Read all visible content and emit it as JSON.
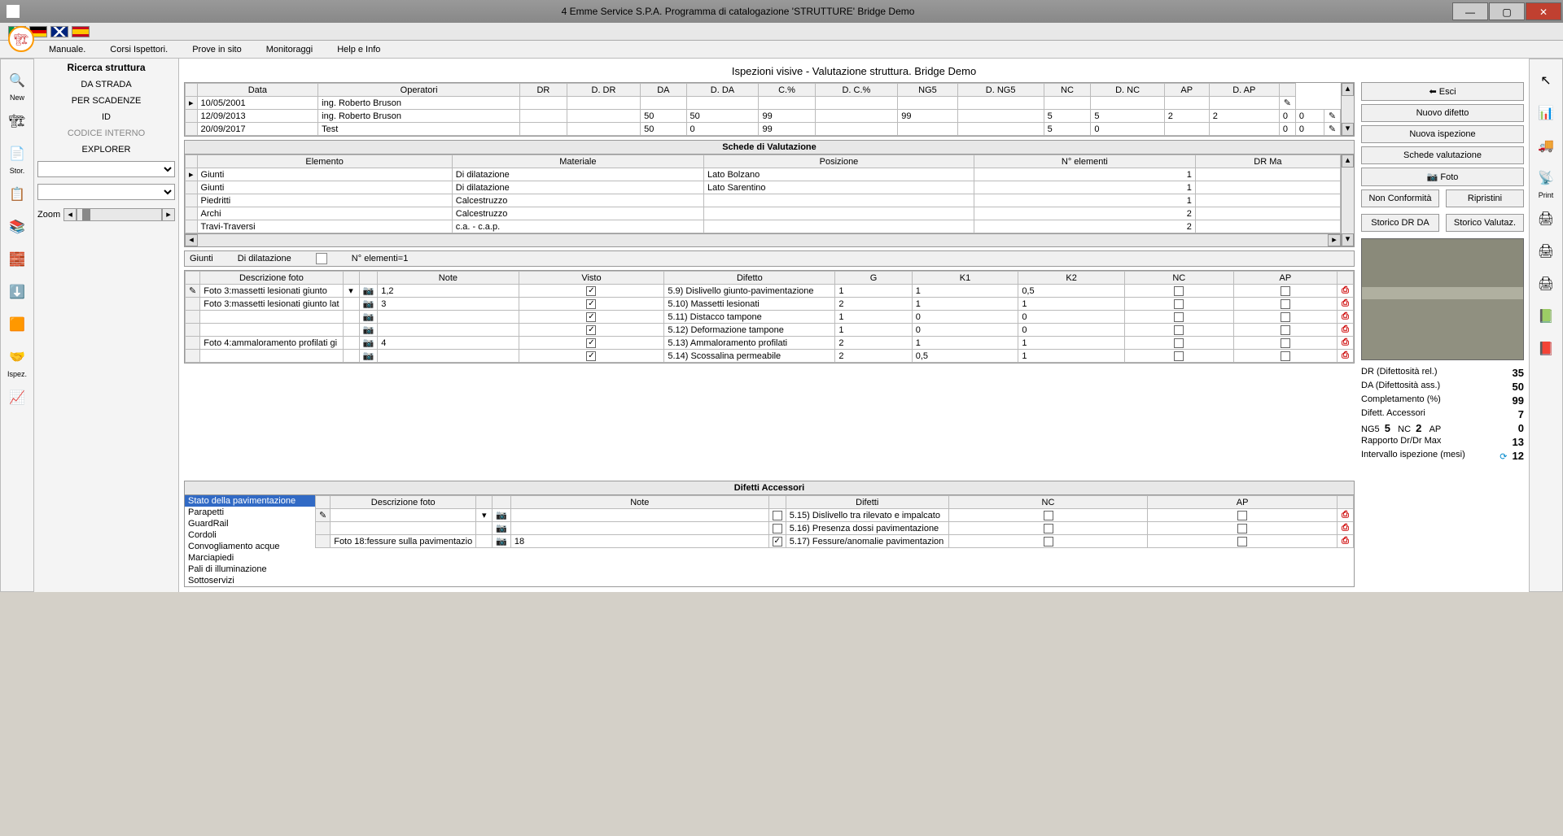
{
  "window": {
    "title": "4 Emme Service S.P.A.  Programma di catalogazione 'STRUTTURE'  Bridge Demo"
  },
  "menus": [
    "Manuale.",
    "Corsi Ispettori.",
    "Prove in sito",
    "Monitoraggi",
    "Help e Info"
  ],
  "leftTools": [
    {
      "icon": "🔍",
      "label": "New"
    },
    {
      "icon": "🏗",
      "label": ""
    },
    {
      "icon": "📄",
      "label": "Stor."
    },
    {
      "icon": "📋",
      "label": ""
    },
    {
      "icon": "📚",
      "label": ""
    },
    {
      "icon": "🧱",
      "label": ""
    },
    {
      "icon": "⬇️",
      "label": ""
    },
    {
      "icon": "🟧",
      "label": ""
    },
    {
      "icon": "🤝",
      "label": "Ispez."
    },
    {
      "icon": "📈",
      "label": ""
    }
  ],
  "rightTools": [
    "↖",
    "📊",
    "🚚",
    "📡",
    "Print",
    "🖨",
    "🖨",
    "🖨",
    "📗",
    "📕"
  ],
  "side": {
    "title": "Ricerca struttura",
    "items": [
      "DA STRADA",
      "PER SCADENZE",
      "ID",
      "CODICE INTERNO",
      "EXPLORER"
    ],
    "zoom": "Zoom"
  },
  "page": {
    "title": "Ispezioni  visive - Valutazione struttura.  Bridge Demo"
  },
  "inspHdr": [
    "Data",
    "Operatori",
    "DR",
    "D. DR",
    "DA",
    "D. DA",
    "C.%",
    "D. C.%",
    "NG5",
    "D. NG5",
    "NC",
    "D. NC",
    "AP",
    "D. AP"
  ],
  "insp": [
    {
      "d": "10/05/2001",
      "op": "ing. Roberto Bruson",
      "v": [
        "",
        "",
        "",
        "",
        "",
        "",
        "",
        "",
        "",
        "",
        "",
        ""
      ]
    },
    {
      "d": "12/09/2013",
      "op": "ing. Roberto Bruson",
      "v": [
        "",
        "",
        "50",
        "50",
        "99",
        "",
        "99",
        "",
        "5",
        "5",
        "2",
        "2",
        "0",
        "0"
      ]
    },
    {
      "d": "20/09/2017",
      "op": "Test",
      "v": [
        "",
        "",
        "50",
        "0",
        "99",
        "",
        "",
        "",
        "5",
        "0",
        "",
        "",
        "0",
        "0"
      ]
    }
  ],
  "schedeTitle": "Schede di Valutazione",
  "schedeHdr": [
    "Elemento",
    "Materiale",
    "Posizione",
    "N° elementi",
    "DR Ma"
  ],
  "schede": [
    {
      "e": "Giunti",
      "m": "Di dilatazione",
      "p": "Lato Bolzano",
      "n": "1",
      "d": ""
    },
    {
      "e": "Giunti",
      "m": "Di dilatazione",
      "p": "Lato Sarentino",
      "n": "1",
      "d": ""
    },
    {
      "e": "Piedritti",
      "m": "Calcestruzzo",
      "p": "",
      "n": "1",
      "d": ""
    },
    {
      "e": "Archi",
      "m": "Calcestruzzo",
      "p": "",
      "n": "2",
      "d": ""
    },
    {
      "e": "Travi-Traversi",
      "m": "c.a. - c.a.p.",
      "p": "",
      "n": "2",
      "d": ""
    }
  ],
  "filter": {
    "a": "Giunti",
    "b": "Di dilatazione",
    "c": "N° elementi=1"
  },
  "defHdr": [
    "Descrizione foto",
    "",
    "",
    "Note",
    "Visto",
    "Difetto",
    "G",
    "K1",
    "K2",
    "NC",
    "AP",
    ""
  ],
  "def": [
    {
      "desc": "Foto 3:massetti lesionati giunto",
      "note": "1,2",
      "visto": true,
      "dif": "5.9) Dislivello giunto-pavimentazione",
      "g": "1",
      "k1": "1",
      "k2": "0,5"
    },
    {
      "desc": "Foto 3:massetti lesionati giunto lat",
      "note": "3",
      "visto": true,
      "dif": "5.10) Massetti lesionati",
      "g": "2",
      "k1": "1",
      "k2": "1"
    },
    {
      "desc": "",
      "note": "",
      "visto": true,
      "dif": "5.11) Distacco tampone",
      "g": "1",
      "k1": "0",
      "k2": "0"
    },
    {
      "desc": "",
      "note": "",
      "visto": true,
      "dif": "5.12) Deformazione tampone",
      "g": "1",
      "k1": "0",
      "k2": "0"
    },
    {
      "desc": "Foto 4:ammaloramento profilati gi",
      "note": "4",
      "visto": true,
      "dif": "5.13) Ammaloramento profilati",
      "g": "2",
      "k1": "1",
      "k2": "1"
    },
    {
      "desc": "",
      "note": "",
      "visto": true,
      "dif": "5.14) Scossalina permeabile",
      "g": "2",
      "k1": "0,5",
      "k2": "1"
    }
  ],
  "buttons": {
    "esci": "Esci",
    "nuovoDifetto": "Nuovo difetto",
    "nuovaIsp": "Nuova ispezione",
    "schedeVal": "Schede valutazione",
    "foto": "Foto",
    "nonConf": "Non Conformità",
    "ripr": "Ripristini",
    "storDR": "Storico DR DA",
    "storVal": "Storico Valutaz."
  },
  "stats": {
    "dr_l": "DR (Difettosità rel.)",
    "dr_v": "35",
    "da_l": "DA (Difettosità ass.)",
    "da_v": "50",
    "comp_l": "Completamento (%)",
    "comp_v": "99",
    "acc_l": "Difett. Accessori",
    "acc_v": "7",
    "ng5": "NG5",
    "ng5_v": "5",
    "nc": "NC",
    "nc_v": "2",
    "ap": "AP",
    "ap_v": "0",
    "rap_l": "Rapporto Dr/Dr Max",
    "rap_v": "13",
    "int_l": "Intervallo ispezione (mesi)",
    "int_v": "12"
  },
  "accTitle": "Difetti Accessori",
  "accList": [
    "Stato della pavimentazione",
    "Parapetti",
    "GuardRail",
    "Cordoli",
    "Convogliamento acque",
    "Marciapiedi",
    "Pali di illuminazione",
    "Sottoservizi"
  ],
  "accHdr": [
    "Descrizione foto",
    "",
    "",
    "Note",
    "",
    "Difetti",
    "NC",
    "AP",
    ""
  ],
  "acc": [
    {
      "desc": "",
      "note": "",
      "chk": false,
      "dif": "5.15) Dislivello tra rilevato e impalcato"
    },
    {
      "desc": "",
      "note": "",
      "chk": false,
      "dif": "5.16) Presenza dossi pavimentazione"
    },
    {
      "desc": "Foto 18:fessure sulla pavimentazio",
      "note": "18",
      "chk": true,
      "dif": "5.17) Fessure/anomalie pavimentazion"
    }
  ]
}
